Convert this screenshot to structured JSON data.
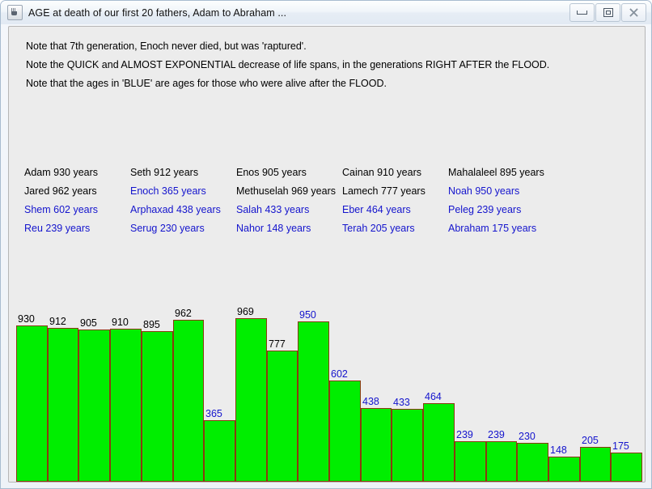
{
  "window": {
    "title": "AGE at death of our first 20 fathers, Adam to Abraham ...",
    "icon": "java-coffee-cup-icon",
    "buttons": {
      "minimize": "minimize-icon",
      "maximize": "maximize-icon",
      "close": "close-icon"
    }
  },
  "notes": [
    "Note that 7th generation, Enoch never died, but was 'raptured'.",
    "Note the QUICK and ALMOST EXPONENTIAL decrease of life spans, in the generations RIGHT AFTER the FLOOD.",
    "Note that the ages in 'BLUE' are ages for those who were alive after the FLOOD."
  ],
  "names_grid": {
    "rows": [
      [
        {
          "text": "Adam 930 years",
          "color": "black"
        },
        {
          "text": "Seth 912 years",
          "color": "black"
        },
        {
          "text": "Enos 905 years",
          "color": "black"
        },
        {
          "text": "Cainan 910 years",
          "color": "black"
        },
        {
          "text": "Mahalaleel 895 years",
          "color": "black"
        }
      ],
      [
        {
          "text": "Jared 962 years",
          "color": "black"
        },
        {
          "text": "Enoch 365 years",
          "color": "blue"
        },
        {
          "text": "Methuselah 969 years",
          "color": "black"
        },
        {
          "text": "Lamech 777 years",
          "color": "black"
        },
        {
          "text": "Noah 950 years",
          "color": "blue"
        }
      ],
      [
        {
          "text": "Shem 602 years",
          "color": "blue"
        },
        {
          "text": "Arphaxad 438 years",
          "color": "blue"
        },
        {
          "text": "Salah 433 years",
          "color": "blue"
        },
        {
          "text": "Eber 464 years",
          "color": "blue"
        },
        {
          "text": "Peleg 239 years",
          "color": "blue"
        }
      ],
      [
        {
          "text": "Reu 239 years",
          "color": "blue"
        },
        {
          "text": "Serug 230 years",
          "color": "blue"
        },
        {
          "text": "Nahor 148 years",
          "color": "blue"
        },
        {
          "text": "Terah 205 years",
          "color": "blue"
        },
        {
          "text": "Abraham 175 years",
          "color": "blue"
        }
      ]
    ]
  },
  "colors": {
    "bar_fill": "#00ee00",
    "bar_border": "#8b3a10",
    "label_black": "#000000",
    "label_blue": "#1414cd",
    "panel_background": "#ececec"
  },
  "chart_data": {
    "type": "bar",
    "title": "AGE at death of our first 20 fathers, Adam to Abraham ...",
    "xlabel": "",
    "ylabel": "",
    "ylim": [
      0,
      1000
    ],
    "grid": false,
    "legend": "none",
    "categories": [
      "Adam",
      "Seth",
      "Enos",
      "Cainan",
      "Mahalaleel",
      "Jared",
      "Enoch",
      "Methuselah",
      "Lamech",
      "Noah",
      "Shem",
      "Arphaxad",
      "Salah",
      "Eber",
      "Peleg",
      "Reu",
      "Serug",
      "Nahor",
      "Terah",
      "Abraham"
    ],
    "values": [
      930,
      912,
      905,
      910,
      895,
      962,
      365,
      969,
      777,
      950,
      602,
      438,
      433,
      464,
      239,
      239,
      230,
      148,
      205,
      175
    ],
    "label_colors": [
      "black",
      "black",
      "black",
      "black",
      "black",
      "black",
      "blue",
      "black",
      "black",
      "blue",
      "blue",
      "blue",
      "blue",
      "blue",
      "blue",
      "blue",
      "blue",
      "blue",
      "blue",
      "blue"
    ]
  }
}
